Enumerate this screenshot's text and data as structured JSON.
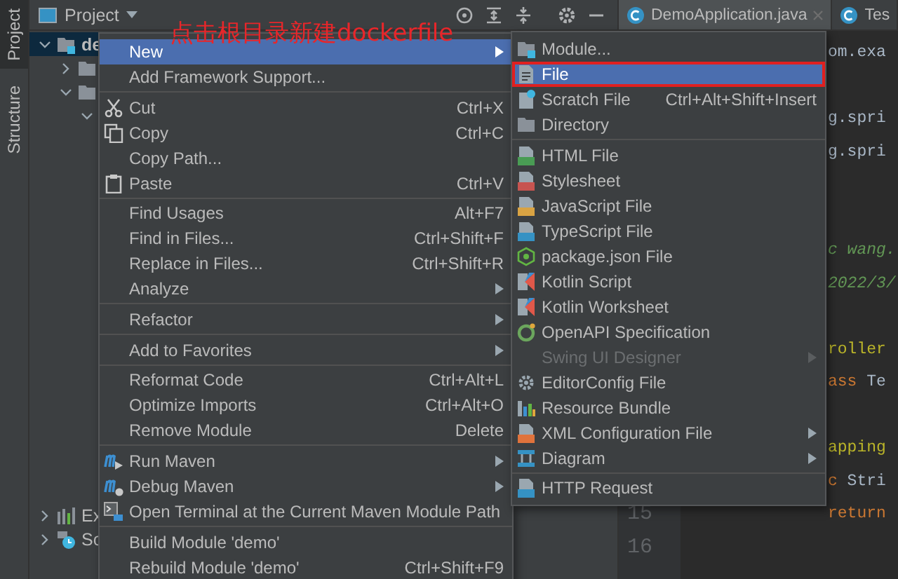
{
  "tool_strip": [
    {
      "label": "Project",
      "selected": true
    },
    {
      "label": "Structure",
      "selected": false
    }
  ],
  "project_panel": {
    "title": "Project",
    "tree": [
      {
        "label": "de",
        "selected": true,
        "expanded": true,
        "kind": "module",
        "children": [
          {
            "kind": "folder",
            "expanded": false
          },
          {
            "kind": "folder",
            "expanded": true,
            "children": [
              {
                "expanded": true
              }
            ]
          }
        ]
      },
      {
        "label": "Ex",
        "selected": false,
        "expanded": false,
        "kind": "library"
      },
      {
        "label": "Sc",
        "selected": false,
        "expanded": false,
        "kind": "scratches"
      }
    ]
  },
  "editor": {
    "tabs": [
      {
        "label": "DemoApplication.java",
        "selected": true,
        "closable": true
      },
      {
        "label": "Tes",
        "selected": false,
        "closable": false
      }
    ],
    "lines": [
      {
        "kind": "code",
        "segments": [
          {
            "text": "om.exa",
            "kind": "plain"
          }
        ]
      },
      {
        "kind": "blank"
      },
      {
        "kind": "code",
        "segments": [
          {
            "text": "g.spri",
            "kind": "plain"
          }
        ]
      },
      {
        "kind": "code",
        "segments": [
          {
            "text": "g.spri",
            "kind": "plain"
          }
        ]
      },
      {
        "kind": "blank"
      },
      {
        "kind": "blank"
      },
      {
        "kind": "code",
        "segments": [
          {
            "text": "c wang.",
            "kind": "comment"
          }
        ]
      },
      {
        "kind": "code",
        "segments": [
          {
            "text": "2022/3/",
            "kind": "comment"
          }
        ]
      },
      {
        "kind": "blank"
      },
      {
        "kind": "code",
        "segments": [
          {
            "text": "roller",
            "kind": "annotation"
          }
        ]
      },
      {
        "kind": "code",
        "segments": [
          {
            "text": "ass",
            "kind": "keyword"
          },
          {
            "text": " Te",
            "kind": "plain"
          }
        ]
      },
      {
        "kind": "blank"
      },
      {
        "kind": "code",
        "segments": [
          {
            "text": "apping",
            "kind": "annotation"
          }
        ]
      },
      {
        "kind": "code",
        "segments": [
          {
            "text": "c",
            "kind": "keyword"
          },
          {
            "text": " Stri",
            "kind": "plain"
          }
        ]
      },
      {
        "kind": "code",
        "number": "15",
        "segments": [
          {
            "text": "return",
            "kind": "keyword"
          }
        ]
      },
      {
        "kind": "code",
        "number": "16"
      }
    ]
  },
  "annotation": "点击根目录新建dockerfile",
  "context_menu": {
    "groups": [
      [
        {
          "label": "New",
          "selected": true,
          "submenu": true
        },
        {
          "label": "Add Framework Support...",
          "selected": false
        }
      ],
      [
        {
          "label": "Cut",
          "kind": "cut",
          "shortcut": "Ctrl+X",
          "selected": false
        },
        {
          "label": "Copy",
          "kind": "copy",
          "shortcut": "Ctrl+C",
          "selected": false
        },
        {
          "label": "Copy Path...",
          "selected": false
        },
        {
          "label": "Paste",
          "kind": "paste",
          "shortcut": "Ctrl+V",
          "selected": false
        }
      ],
      [
        {
          "label": "Find Usages",
          "shortcut": "Alt+F7",
          "selected": false
        },
        {
          "label": "Find in Files...",
          "shortcut": "Ctrl+Shift+F",
          "selected": false
        },
        {
          "label": "Replace in Files...",
          "shortcut": "Ctrl+Shift+R",
          "selected": false
        },
        {
          "label": "Analyze",
          "submenu": true,
          "selected": false
        }
      ],
      [
        {
          "label": "Refactor",
          "submenu": true,
          "selected": false
        }
      ],
      [
        {
          "label": "Add to Favorites",
          "submenu": true,
          "selected": false
        }
      ],
      [
        {
          "label": "Reformat Code",
          "shortcut": "Ctrl+Alt+L",
          "selected": false
        },
        {
          "label": "Optimize Imports",
          "shortcut": "Ctrl+Alt+O",
          "selected": false
        },
        {
          "label": "Remove Module",
          "shortcut": "Delete",
          "selected": false
        }
      ],
      [
        {
          "label": "Run Maven",
          "kind": "maven-run",
          "submenu": true,
          "selected": false
        },
        {
          "label": "Debug Maven",
          "kind": "maven-debug",
          "submenu": true,
          "selected": false
        },
        {
          "label": "Open Terminal at the Current Maven Module Path",
          "kind": "terminal",
          "selected": false
        }
      ],
      [
        {
          "label": "Build Module 'demo'",
          "selected": false
        },
        {
          "label": "Rebuild Module 'demo'",
          "shortcut": "Ctrl+Shift+F9",
          "selected": false
        }
      ]
    ]
  },
  "submenu": {
    "groups": [
      [
        {
          "label": "Module...",
          "kind": "module",
          "selected": false
        },
        {
          "label": "File",
          "kind": "file",
          "selected": true,
          "highlighted": true
        },
        {
          "label": "Scratch File",
          "kind": "scratch",
          "shortcut": "Ctrl+Alt+Shift+Insert",
          "selected": false
        },
        {
          "label": "Directory",
          "kind": "directory",
          "selected": false
        }
      ],
      [
        {
          "label": "HTML File",
          "kind": "html",
          "selected": false
        },
        {
          "label": "Stylesheet",
          "kind": "css",
          "selected": false
        },
        {
          "label": "JavaScript File",
          "kind": "js",
          "selected": false
        },
        {
          "label": "TypeScript File",
          "kind": "ts",
          "selected": false
        },
        {
          "label": "package.json File",
          "kind": "npm",
          "selected": false
        },
        {
          "label": "Kotlin Script",
          "kind": "kotlin",
          "selected": false
        },
        {
          "label": "Kotlin Worksheet",
          "kind": "kotlin",
          "selected": false
        },
        {
          "label": "OpenAPI Specification",
          "kind": "openapi",
          "selected": false
        },
        {
          "label": "Swing UI Designer",
          "disabled": true,
          "submenu": true,
          "selected": false
        },
        {
          "label": "EditorConfig File",
          "kind": "editorconfig",
          "selected": false
        },
        {
          "label": "Resource Bundle",
          "kind": "bundle",
          "selected": false
        },
        {
          "label": "XML Configuration File",
          "kind": "xml",
          "submenu": true,
          "selected": false
        },
        {
          "label": "Diagram",
          "kind": "diagram",
          "submenu": true,
          "selected": false
        }
      ],
      [
        {
          "label": "HTTP Request",
          "kind": "http",
          "selected": false
        }
      ]
    ]
  }
}
